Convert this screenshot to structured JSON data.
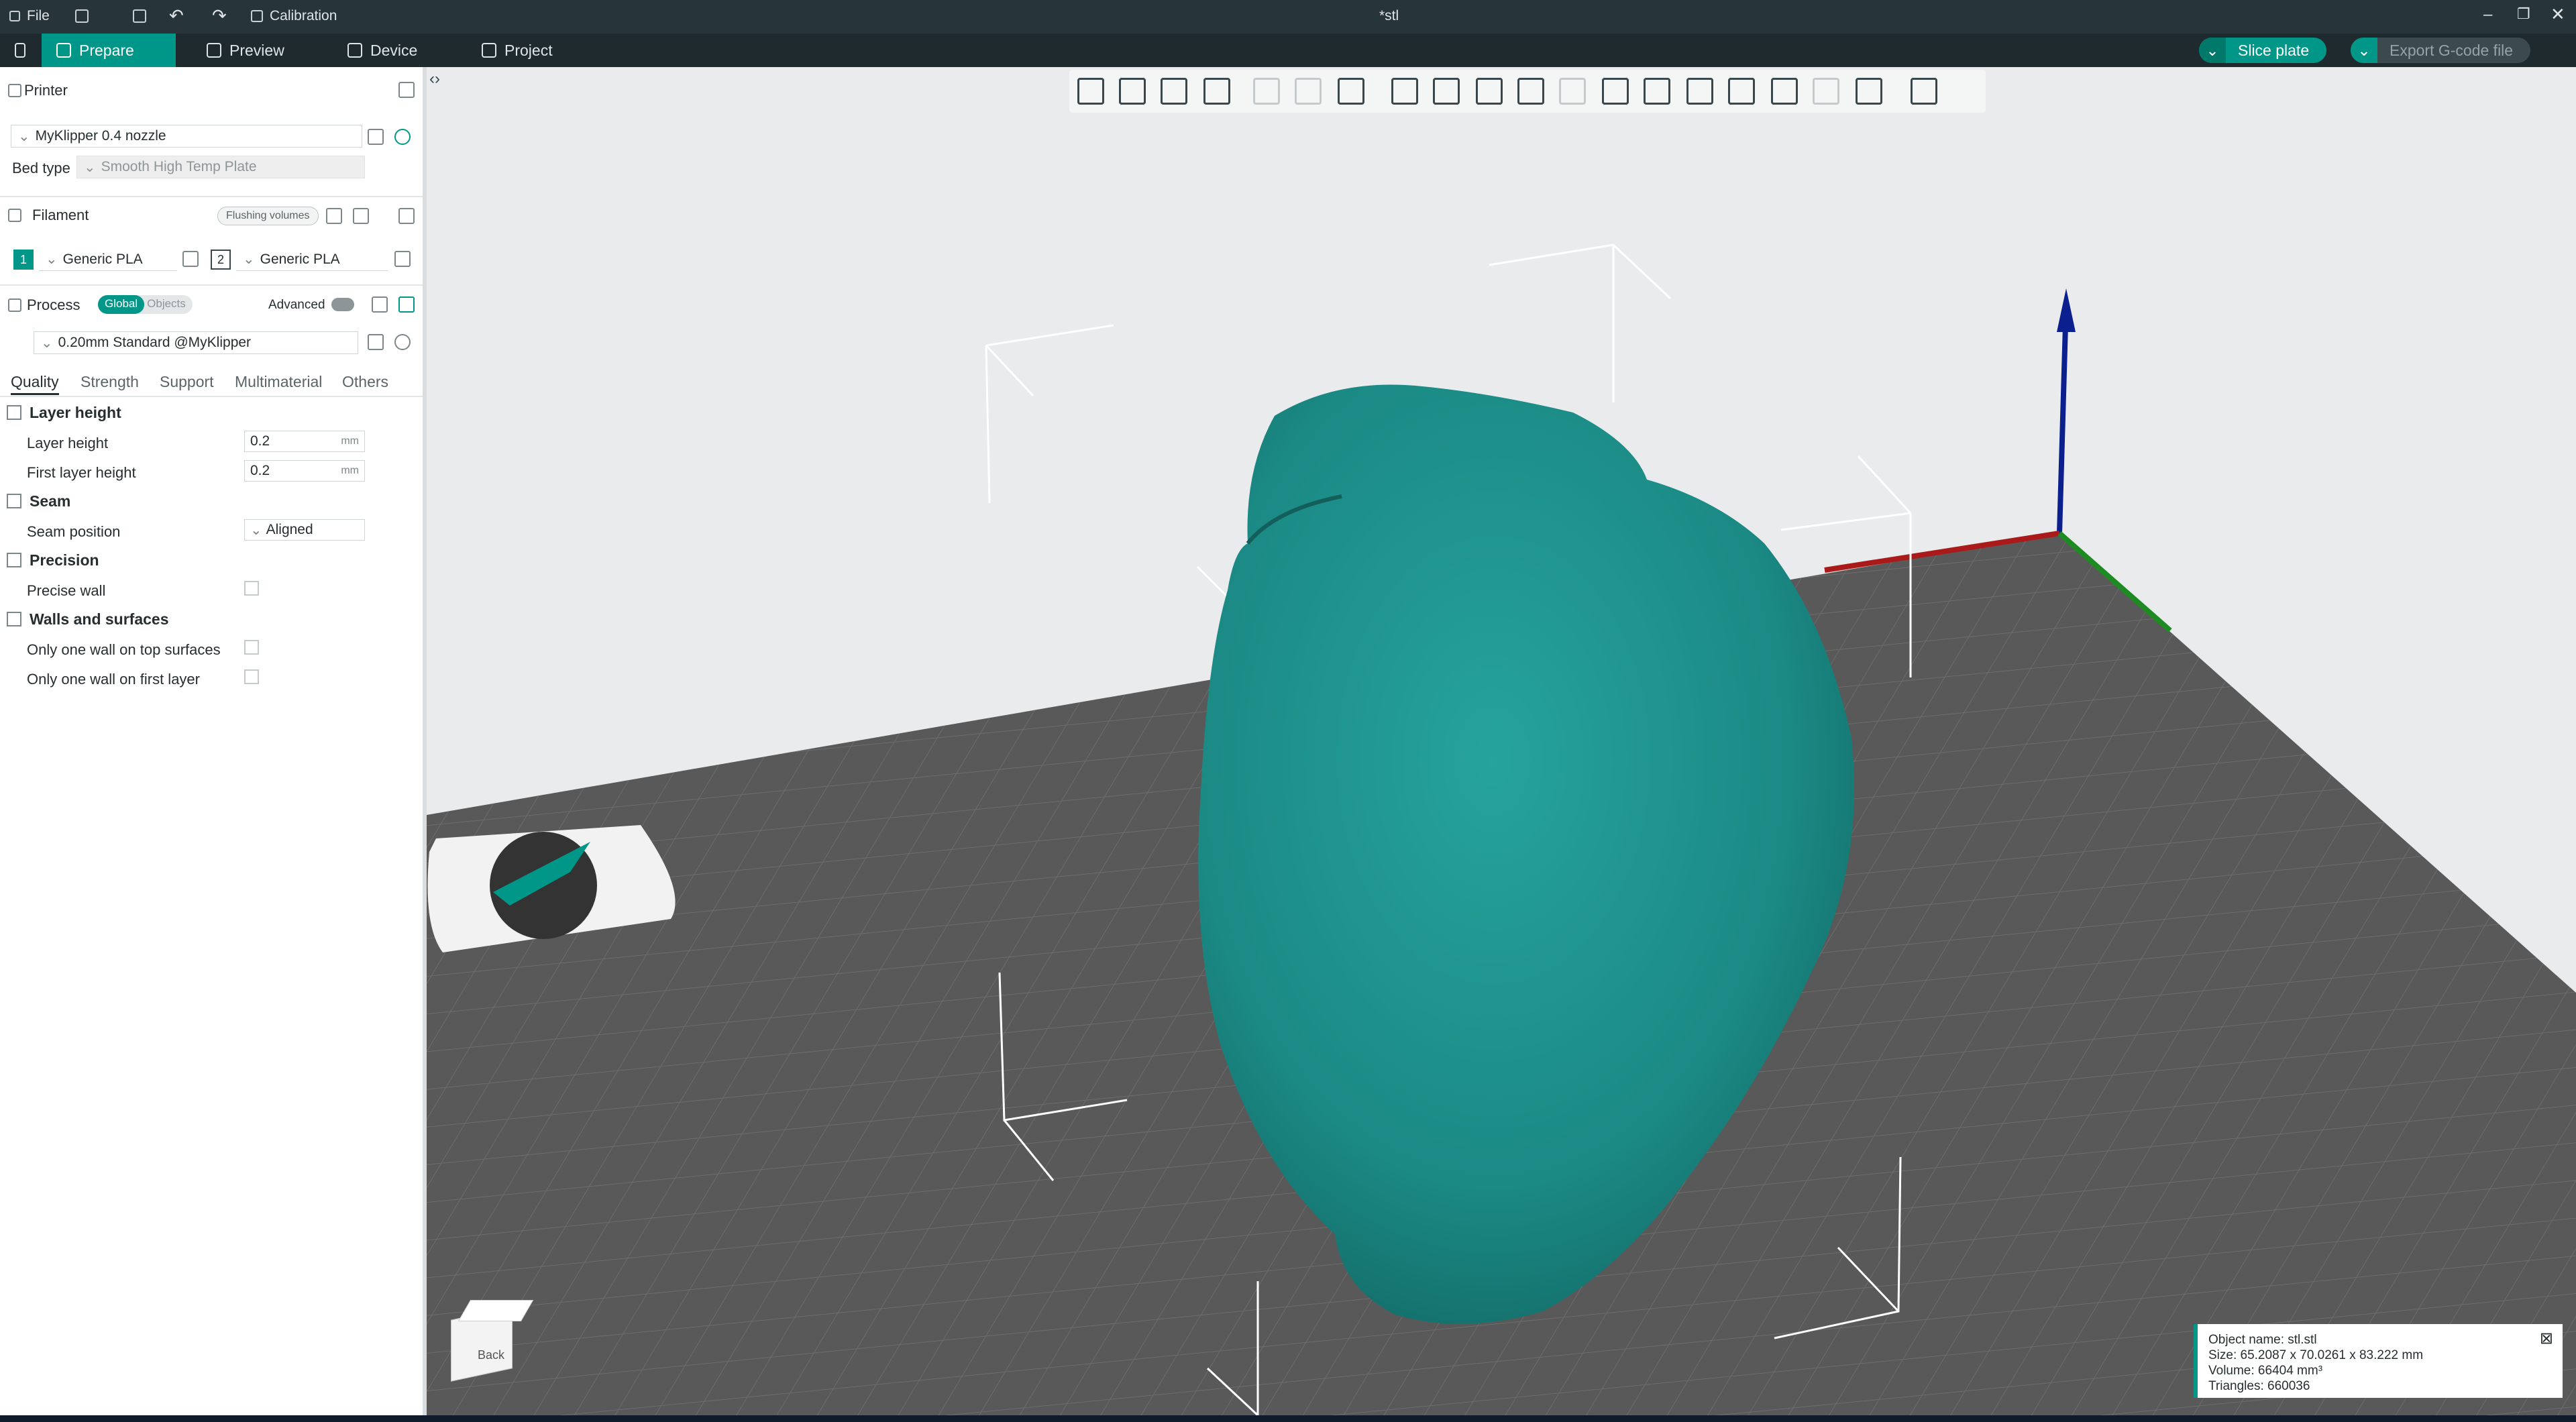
{
  "titlebar": {
    "file": "File",
    "calibration": "Calibration",
    "doc_title": "*stl"
  },
  "nav": {
    "prepare": "Prepare",
    "preview": "Preview",
    "device": "Device",
    "project": "Project",
    "slice": "Slice plate",
    "export": "Export G-code file"
  },
  "printer": {
    "header": "Printer",
    "name": "MyKlipper 0.4 nozzle",
    "bed_label": "Bed type",
    "bed_value": "Smooth High Temp Plate"
  },
  "filament": {
    "header": "Filament",
    "flushing": "Flushing volumes",
    "slot1": "1",
    "slot1_name": "Generic PLA",
    "slot2": "2",
    "slot2_name": "Generic PLA"
  },
  "process": {
    "header": "Process",
    "global": "Global",
    "objects": "Objects",
    "advanced": "Advanced",
    "preset": "0.20mm Standard @MyKlipper"
  },
  "tabs": [
    "Quality",
    "Strength",
    "Support",
    "Multimaterial",
    "Others"
  ],
  "settings": {
    "layer_height_group": "Layer height",
    "layer_height_label": "Layer height",
    "layer_height_value": "0.2",
    "first_layer_label": "First layer height",
    "first_layer_value": "0.2",
    "unit": "mm",
    "seam_group": "Seam",
    "seam_label": "Seam position",
    "seam_value": "Aligned",
    "precision_group": "Precision",
    "precise_wall": "Precise wall",
    "walls_group": "Walls and surfaces",
    "one_wall_top": "Only one wall on top surfaces",
    "one_wall_first": "Only one wall on first layer"
  },
  "cube": {
    "label": "Back"
  },
  "info": {
    "name": "Object name: stl.stl",
    "size": "Size: 65.2087 x 70.0261 x 83.222 mm",
    "volume": "Volume: 66404 mm³",
    "triangles": "Triangles: 660036"
  },
  "colors": {
    "accent": "#009688",
    "model": "#1e8b86",
    "bed": "#595959",
    "background": "#e9ebec"
  }
}
